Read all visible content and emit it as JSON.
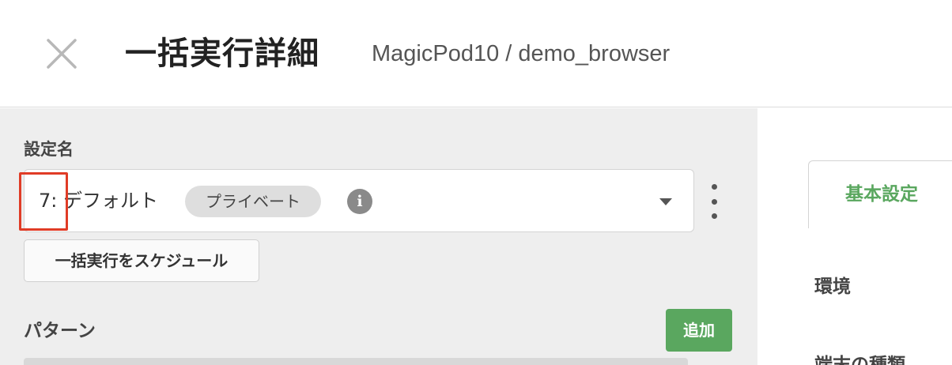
{
  "header": {
    "title": "一括実行詳細",
    "breadcrumb": "MagicPod10 / demo_browser"
  },
  "setting": {
    "label": "設定名",
    "selected_value": "7: デフォルト",
    "visibility_badge": "プライベート",
    "info_icon_glyph": "i"
  },
  "actions": {
    "schedule_button": "一括実行をスケジュール",
    "add_button": "追加"
  },
  "pattern": {
    "label": "パターン"
  },
  "right_panel": {
    "tab_label": "基本設定",
    "environment_label": "環境",
    "device_type_label": "端末の種類"
  },
  "colors": {
    "accent_green": "#5aa75f",
    "highlight_red": "#e03c26",
    "panel_gray": "#eeeeee"
  },
  "icons": {
    "close": "close-icon",
    "info": "info-icon",
    "dropdown": "chevron-down-icon",
    "more": "more-vertical-icon"
  }
}
